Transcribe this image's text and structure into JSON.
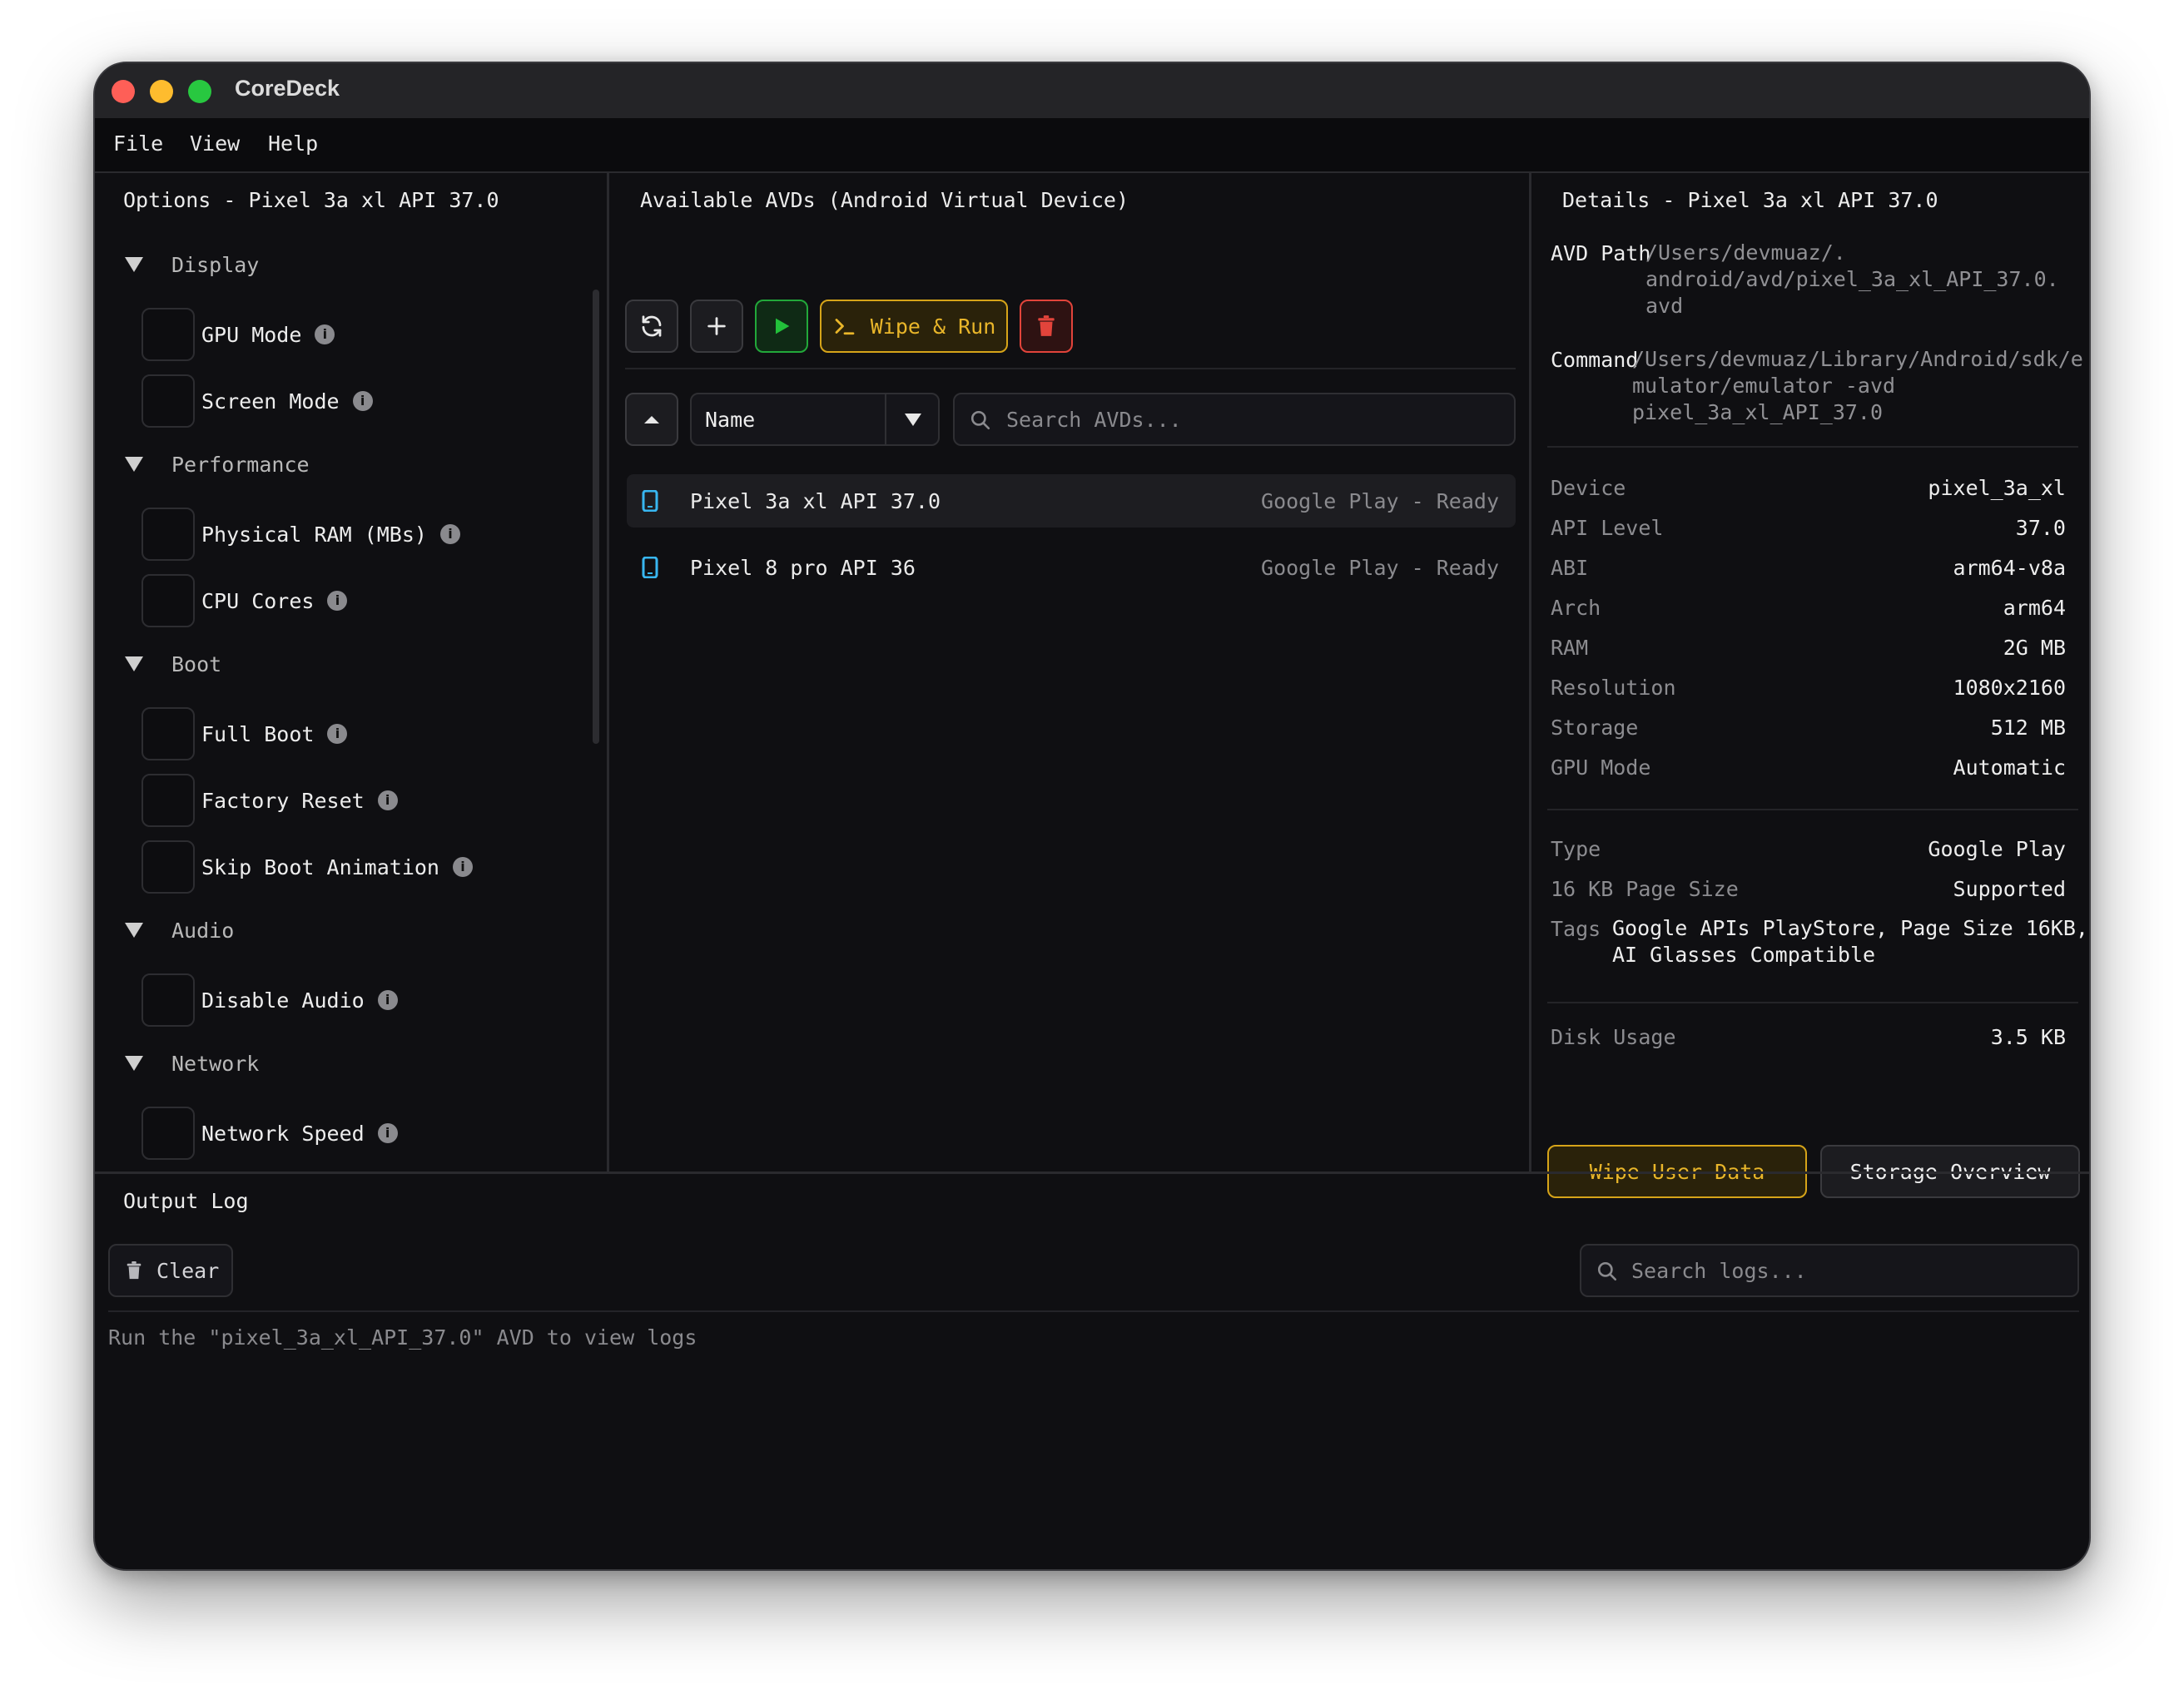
{
  "app": {
    "title": "CoreDeck"
  },
  "menu": [
    "File",
    "View",
    "Help"
  ],
  "options": {
    "title": "Options - Pixel 3a xl API 37.0",
    "sections": [
      {
        "name": "Display",
        "items": [
          "GPU Mode",
          "Screen Mode"
        ]
      },
      {
        "name": "Performance",
        "items": [
          "Physical RAM (MBs)",
          "CPU Cores"
        ]
      },
      {
        "name": "Boot",
        "items": [
          "Full Boot",
          "Factory Reset",
          "Skip Boot Animation"
        ]
      },
      {
        "name": "Audio",
        "items": [
          "Disable Audio"
        ]
      },
      {
        "name": "Network",
        "items": [
          "Network Speed"
        ]
      }
    ]
  },
  "avds": {
    "title": "Available AVDs (Android Virtual Device)",
    "wipe_run_label": "Wipe & Run",
    "sort_label": "Name",
    "search_placeholder": "Search AVDs...",
    "list": [
      {
        "name": "Pixel 3a xl API 37.0",
        "status": "Google Play - Ready"
      },
      {
        "name": "Pixel 8 pro API 36",
        "status": "Google Play - Ready"
      }
    ]
  },
  "details": {
    "title": "Details - Pixel 3a xl API 37.0",
    "avd_path_label": "AVD Path",
    "avd_path_lines": [
      "/Users/devmuaz/.",
      "android/avd/pixel_3a_xl_API_37.0.",
      "avd"
    ],
    "command_label": "Command",
    "command_lines": [
      "/Users/devmuaz/Library/Android/sdk/e",
      "mulator/emulator -avd",
      "pixel_3a_xl_API_37.0"
    ],
    "specs": [
      {
        "label": "Device",
        "value": "pixel_3a_xl"
      },
      {
        "label": "API Level",
        "value": "37.0"
      },
      {
        "label": "ABI",
        "value": "arm64-v8a"
      },
      {
        "label": "Arch",
        "value": "arm64"
      },
      {
        "label": "RAM",
        "value": "2G MB"
      },
      {
        "label": "Resolution",
        "value": "1080x2160"
      },
      {
        "label": "Storage",
        "value": "512 MB"
      },
      {
        "label": "GPU Mode",
        "value": "Automatic"
      }
    ],
    "type_label": "Type",
    "type_value": "Google Play",
    "page_size_label": "16 KB Page Size",
    "page_size_value": "Supported",
    "tags_label": "Tags",
    "tags_lines": [
      "Google APIs PlayStore, Page Size 16KB,",
      "AI Glasses Compatible"
    ],
    "disk_label": "Disk Usage",
    "disk_value": "3.5 KB",
    "wipe_button": "Wipe User Data",
    "storage_button": "Storage Overview"
  },
  "output": {
    "title": "Output Log",
    "clear_label": "Clear",
    "search_placeholder": "Search logs...",
    "message": "Run the \"pixel_3a_xl_API_37.0\" AVD to view logs"
  },
  "colors": {
    "accent_yellow": "#e9b62a",
    "accent_green": "#22c03a",
    "accent_red": "#e2443b",
    "device_icon_blue": "#38b6f0"
  }
}
